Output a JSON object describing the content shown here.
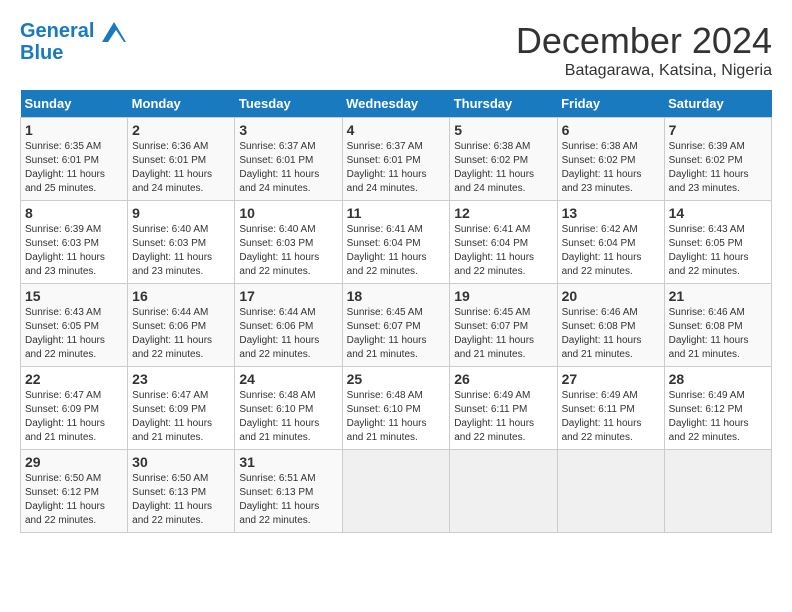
{
  "header": {
    "logo_line1": "General",
    "logo_line2": "Blue",
    "month": "December 2024",
    "location": "Batagarawa, Katsina, Nigeria"
  },
  "weekdays": [
    "Sunday",
    "Monday",
    "Tuesday",
    "Wednesday",
    "Thursday",
    "Friday",
    "Saturday"
  ],
  "weeks": [
    [
      {
        "day": 1,
        "info": "Sunrise: 6:35 AM\nSunset: 6:01 PM\nDaylight: 11 hours\nand 25 minutes."
      },
      {
        "day": 2,
        "info": "Sunrise: 6:36 AM\nSunset: 6:01 PM\nDaylight: 11 hours\nand 24 minutes."
      },
      {
        "day": 3,
        "info": "Sunrise: 6:37 AM\nSunset: 6:01 PM\nDaylight: 11 hours\nand 24 minutes."
      },
      {
        "day": 4,
        "info": "Sunrise: 6:37 AM\nSunset: 6:01 PM\nDaylight: 11 hours\nand 24 minutes."
      },
      {
        "day": 5,
        "info": "Sunrise: 6:38 AM\nSunset: 6:02 PM\nDaylight: 11 hours\nand 24 minutes."
      },
      {
        "day": 6,
        "info": "Sunrise: 6:38 AM\nSunset: 6:02 PM\nDaylight: 11 hours\nand 23 minutes."
      },
      {
        "day": 7,
        "info": "Sunrise: 6:39 AM\nSunset: 6:02 PM\nDaylight: 11 hours\nand 23 minutes."
      }
    ],
    [
      {
        "day": 8,
        "info": "Sunrise: 6:39 AM\nSunset: 6:03 PM\nDaylight: 11 hours\nand 23 minutes."
      },
      {
        "day": 9,
        "info": "Sunrise: 6:40 AM\nSunset: 6:03 PM\nDaylight: 11 hours\nand 23 minutes."
      },
      {
        "day": 10,
        "info": "Sunrise: 6:40 AM\nSunset: 6:03 PM\nDaylight: 11 hours\nand 22 minutes."
      },
      {
        "day": 11,
        "info": "Sunrise: 6:41 AM\nSunset: 6:04 PM\nDaylight: 11 hours\nand 22 minutes."
      },
      {
        "day": 12,
        "info": "Sunrise: 6:41 AM\nSunset: 6:04 PM\nDaylight: 11 hours\nand 22 minutes."
      },
      {
        "day": 13,
        "info": "Sunrise: 6:42 AM\nSunset: 6:04 PM\nDaylight: 11 hours\nand 22 minutes."
      },
      {
        "day": 14,
        "info": "Sunrise: 6:43 AM\nSunset: 6:05 PM\nDaylight: 11 hours\nand 22 minutes."
      }
    ],
    [
      {
        "day": 15,
        "info": "Sunrise: 6:43 AM\nSunset: 6:05 PM\nDaylight: 11 hours\nand 22 minutes."
      },
      {
        "day": 16,
        "info": "Sunrise: 6:44 AM\nSunset: 6:06 PM\nDaylight: 11 hours\nand 22 minutes."
      },
      {
        "day": 17,
        "info": "Sunrise: 6:44 AM\nSunset: 6:06 PM\nDaylight: 11 hours\nand 22 minutes."
      },
      {
        "day": 18,
        "info": "Sunrise: 6:45 AM\nSunset: 6:07 PM\nDaylight: 11 hours\nand 21 minutes."
      },
      {
        "day": 19,
        "info": "Sunrise: 6:45 AM\nSunset: 6:07 PM\nDaylight: 11 hours\nand 21 minutes."
      },
      {
        "day": 20,
        "info": "Sunrise: 6:46 AM\nSunset: 6:08 PM\nDaylight: 11 hours\nand 21 minutes."
      },
      {
        "day": 21,
        "info": "Sunrise: 6:46 AM\nSunset: 6:08 PM\nDaylight: 11 hours\nand 21 minutes."
      }
    ],
    [
      {
        "day": 22,
        "info": "Sunrise: 6:47 AM\nSunset: 6:09 PM\nDaylight: 11 hours\nand 21 minutes."
      },
      {
        "day": 23,
        "info": "Sunrise: 6:47 AM\nSunset: 6:09 PM\nDaylight: 11 hours\nand 21 minutes."
      },
      {
        "day": 24,
        "info": "Sunrise: 6:48 AM\nSunset: 6:10 PM\nDaylight: 11 hours\nand 21 minutes."
      },
      {
        "day": 25,
        "info": "Sunrise: 6:48 AM\nSunset: 6:10 PM\nDaylight: 11 hours\nand 21 minutes."
      },
      {
        "day": 26,
        "info": "Sunrise: 6:49 AM\nSunset: 6:11 PM\nDaylight: 11 hours\nand 22 minutes."
      },
      {
        "day": 27,
        "info": "Sunrise: 6:49 AM\nSunset: 6:11 PM\nDaylight: 11 hours\nand 22 minutes."
      },
      {
        "day": 28,
        "info": "Sunrise: 6:49 AM\nSunset: 6:12 PM\nDaylight: 11 hours\nand 22 minutes."
      }
    ],
    [
      {
        "day": 29,
        "info": "Sunrise: 6:50 AM\nSunset: 6:12 PM\nDaylight: 11 hours\nand 22 minutes."
      },
      {
        "day": 30,
        "info": "Sunrise: 6:50 AM\nSunset: 6:13 PM\nDaylight: 11 hours\nand 22 minutes."
      },
      {
        "day": 31,
        "info": "Sunrise: 6:51 AM\nSunset: 6:13 PM\nDaylight: 11 hours\nand 22 minutes."
      },
      null,
      null,
      null,
      null
    ]
  ]
}
